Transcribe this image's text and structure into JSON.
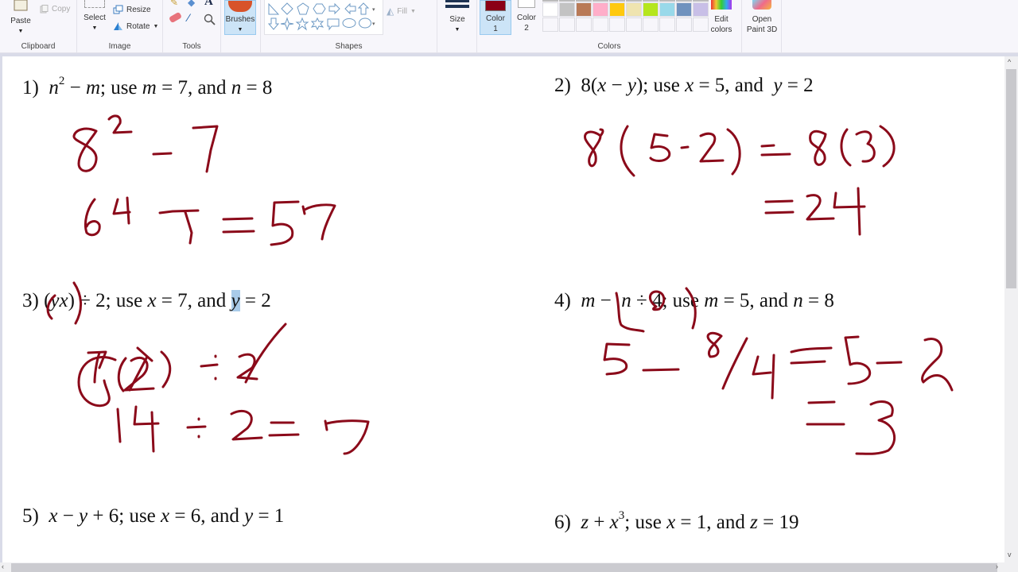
{
  "ribbon": {
    "clipboard": {
      "label": "Clipboard",
      "paste": "Paste",
      "copy": "Copy"
    },
    "image": {
      "label": "Image",
      "select": "Select",
      "resize": "Resize",
      "rotate": "Rotate"
    },
    "tools": {
      "label": "Tools"
    },
    "brushes": {
      "label": "Brushes"
    },
    "shapes": {
      "label": "Shapes",
      "fill": "Fill"
    },
    "size": {
      "label": "Size"
    },
    "colors": {
      "label": "Colors",
      "color1_line1": "Color",
      "color1_line2": "1",
      "color1_value": "#8b0016",
      "color2_line1": "Color",
      "color2_line2": "2",
      "color2_value": "#ffffff",
      "palette_row2": [
        "#ffffff",
        "#c3c3c3",
        "#b97a57",
        "#ffaec9",
        "#ffc90e",
        "#efe4b0",
        "#b5e61d",
        "#99d9ea",
        "#7092be",
        "#c8bfe7"
      ],
      "edit_line1": "Edit",
      "edit_line2": "colors"
    },
    "paint3d": {
      "line1": "Open",
      "line2": "Paint 3D"
    }
  },
  "problems": [
    {
      "num": "1)",
      "expr": "n² − m; use m = 7, and n = 8"
    },
    {
      "num": "2)",
      "expr": "8(x − y); use x = 5, and y = 2"
    },
    {
      "num": "3)",
      "expr": "(yx) ÷ 2; use x = 7, and y = 2"
    },
    {
      "num": "4)",
      "expr": "m − n ÷ 4; use m = 5, and n = 8"
    },
    {
      "num": "5)",
      "expr": "x − y + 6; use x = 6, and y = 1"
    },
    {
      "num": "6)",
      "expr": "z + x³; use x = 1, and z = 19"
    }
  ],
  "handwritten_work": [
    {
      "problem": "1)",
      "lines": [
        "8² − 7",
        "64 − 7 = 57"
      ]
    },
    {
      "problem": "2)",
      "lines": [
        "8(5 − 2) = 8(3)",
        "= 24"
      ]
    },
    {
      "problem": "3)",
      "lines": [
        "(7)(2) ÷ 2",
        "14 ÷ 2 = 7"
      ]
    },
    {
      "problem": "4)",
      "lines": [
        "5 − 8/4 = 5 − 2",
        "= 3"
      ]
    }
  ],
  "ink_color": "#8b0a1a"
}
